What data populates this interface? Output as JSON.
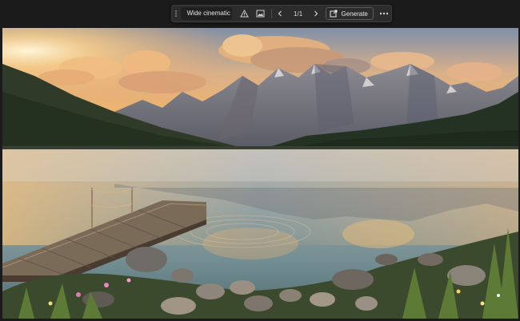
{
  "taskbar": {
    "prompt_text": "Wide cinematic v",
    "counter": "1/1",
    "generate_label": "Generate",
    "icons": {
      "grip": "drag-handle-icon",
      "warning": "alert-triangle-icon",
      "image": "reference-image-icon",
      "prev": "chevron-left-icon",
      "next": "chevron-right-icon",
      "generate": "generate-icon",
      "more": "more-options-icon"
    }
  },
  "canvas": {
    "subject": "mountain-lake-photo"
  },
  "colors": {
    "app_bg": "#1b1b1b",
    "taskbar_bg": "#2c2c2c",
    "sky_warm": "#f2b46a",
    "lake": "#8aa3a8"
  }
}
